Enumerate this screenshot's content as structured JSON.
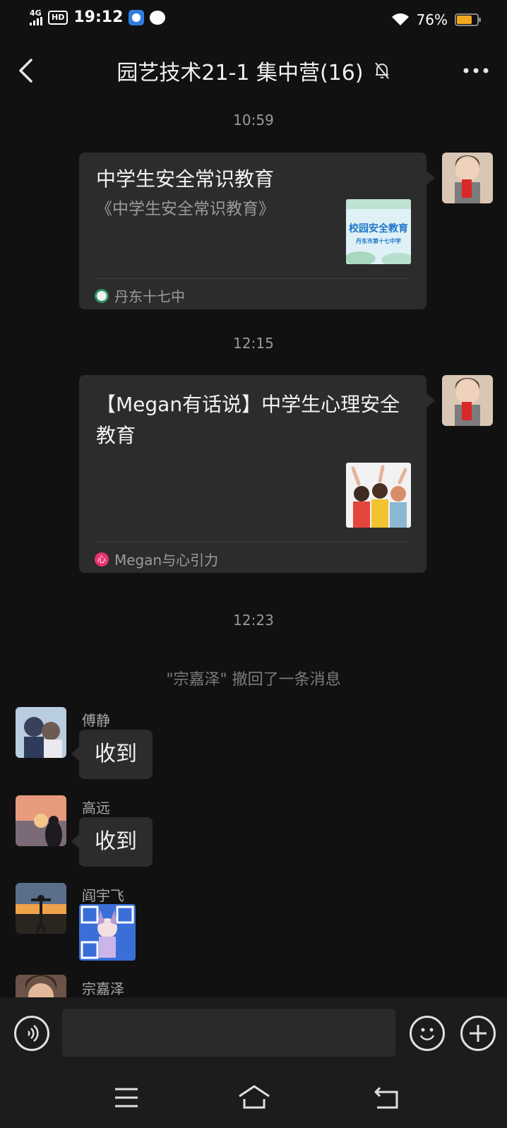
{
  "status_bar": {
    "time": "19:12",
    "network": "4G",
    "hd_label": "HD",
    "battery": "76%",
    "battery_level": 0.76
  },
  "header": {
    "title": "园艺技术21-1 集中营(16)"
  },
  "messages": [
    {
      "timestamp": "10:59",
      "card_title": "中学生安全常识教育",
      "card_desc": "《中学生安全常识教育》",
      "thumb_line1": "校园安全教育",
      "thumb_line2": "丹东市第十七中学",
      "source": "丹东十七中"
    },
    {
      "timestamp": "12:15",
      "card_title": "【Megan有话说】中学生心理安全教育",
      "source": "Megan与心引力",
      "source_glyph": "心"
    }
  ],
  "timestamp_3": "12:23",
  "recall_notice": "\"宗嘉泽\" 撤回了一条消息",
  "group_messages": [
    {
      "sender": "傅静",
      "text": "收到"
    },
    {
      "sender": "高远",
      "text": "收到"
    },
    {
      "sender": "阎宇飞"
    },
    {
      "sender": "宗嘉泽"
    }
  ],
  "input": {
    "placeholder": ""
  },
  "colors": {
    "background": "#111111",
    "bubble": "#2c2c2c",
    "battery": "#f2a81d",
    "megan_accent": "#e8336e"
  },
  "icons": [
    "back-arrow-icon",
    "mute-bell-icon",
    "more-icon",
    "voice-icon",
    "emoji-icon",
    "plus-icon",
    "menu-icon",
    "home-icon",
    "back-icon"
  ]
}
